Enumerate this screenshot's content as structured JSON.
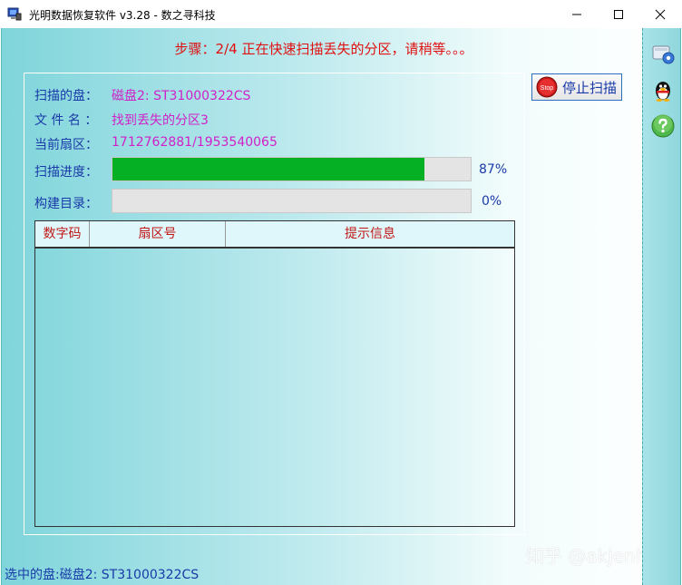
{
  "window": {
    "title": "光明数据恢复软件 v3.28 - 数之寻科技"
  },
  "step": {
    "text": "步骤：2/4 正在快速扫描丢失的分区，请稍等。。。"
  },
  "info": {
    "disk_label": "扫描的盘：",
    "disk_value": "磁盘2: ST31000322CS",
    "file_label": "文 件 名 ：",
    "file_value": "找到丢失的分区3",
    "sector_label": "当前扇区：",
    "sector_value": "1712762881/1953540065"
  },
  "progress": {
    "scan_label": "扫描进度：",
    "scan_percent": 87,
    "scan_text": "87%",
    "build_label": "构建目录：",
    "build_percent": 0,
    "build_text": "0%"
  },
  "stop_button": {
    "label": "停止扫描",
    "icon_text": "Stop"
  },
  "table": {
    "columns": [
      "数字码",
      "扇区号",
      "提示信息"
    ],
    "rows": []
  },
  "status": {
    "text": "选中的盘:磁盘2: ST31000322CS"
  },
  "watermark": {
    "text": "知乎 @akjenhd"
  },
  "colors": {
    "accent_red": "#e01010",
    "label_blue": "#1a3aa8",
    "value_magenta": "#d020c8",
    "progress_green": "#06b025"
  },
  "icons": {
    "app": "app-monitor-icon",
    "side1": "settings-disk-icon",
    "side2": "qq-penguin-icon",
    "side3": "help-icon",
    "stop": "stop-sign-icon"
  }
}
